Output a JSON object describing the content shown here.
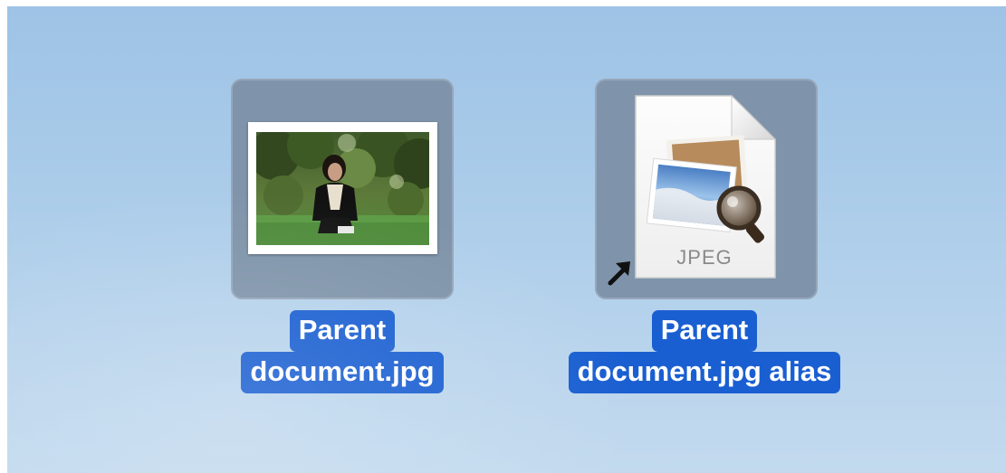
{
  "desktop": {
    "items": [
      {
        "label_line1": "Parent",
        "label_line2": "document.jpg",
        "type": "photo",
        "selected": true
      },
      {
        "label_line1": "Parent",
        "label_line2": "document.jpg alias",
        "type": "alias",
        "doc_badge": "JPEG",
        "selected": true
      }
    ]
  },
  "colors": {
    "selection_label_bg": "#1a5fd1",
    "selection_icon_bg": "#7f94aa",
    "desktop_bg": "#a9cbe9"
  },
  "icons": {
    "photo_thumbnail": "photo-thumbnail-icon",
    "jpeg_document": "jpeg-document-icon",
    "alias_arrow": "alias-arrow-icon"
  }
}
